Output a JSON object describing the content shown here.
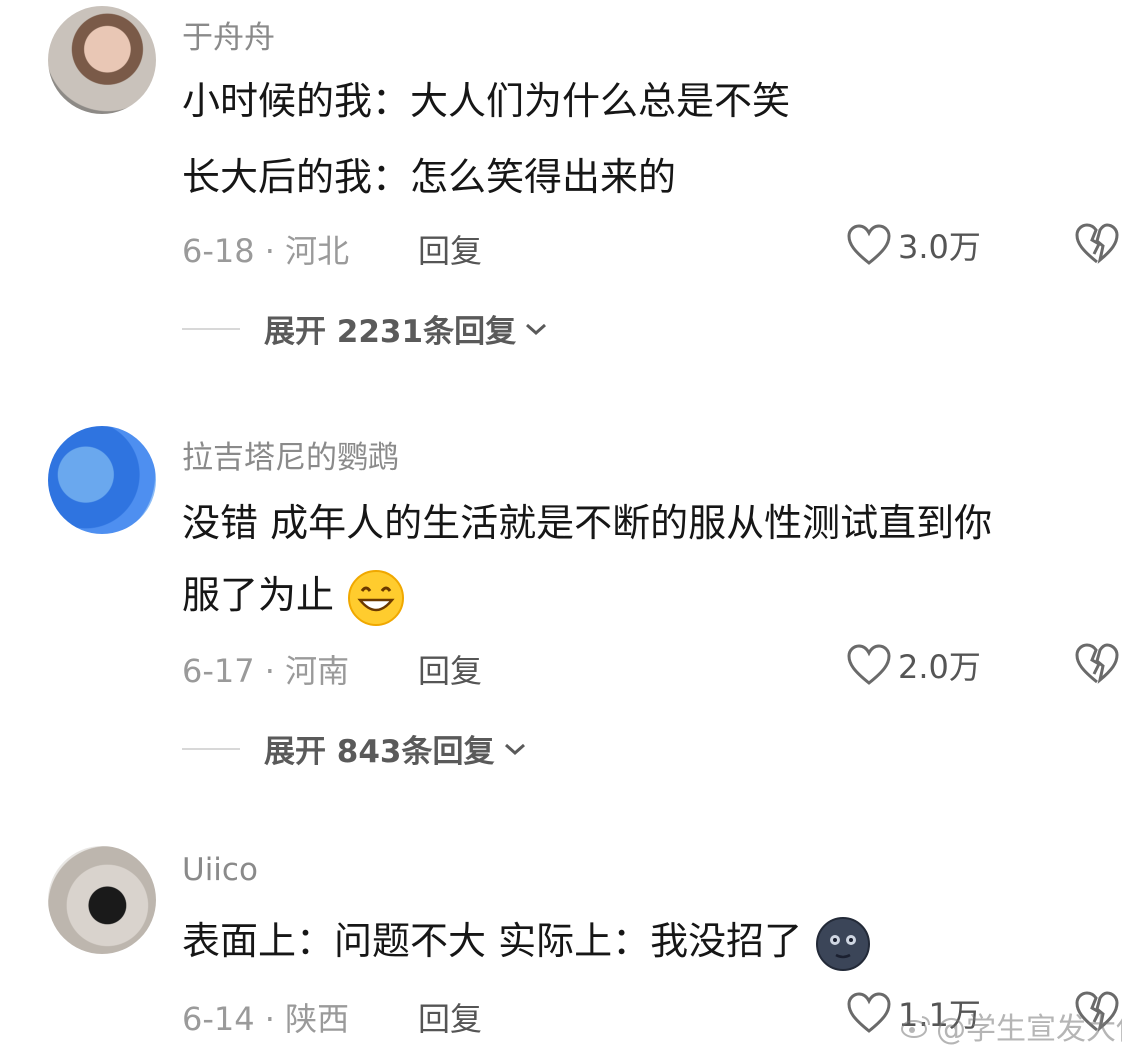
{
  "comments": [
    {
      "username": "于舟舟",
      "lines": [
        "小时候的我：大人们为什么总是不笑",
        "长大后的我：怎么笑得出来的"
      ],
      "date_location": "6-18 · 河北",
      "reply_label": "回复",
      "likes": "3.0万",
      "expand_label": "展开 2231条回复"
    },
    {
      "username": "拉吉塔尼的鹦鹉",
      "lines": [
        "没错 成年人的生活就是不断的服从性测试直到你",
        "服了为止"
      ],
      "date_location": "6-17 · 河南",
      "reply_label": "回复",
      "likes": "2.0万",
      "expand_label": "展开 843条回复"
    },
    {
      "username": "Uiico",
      "lines": [
        "表面上：问题不大 实际上：我没招了"
      ],
      "date_location": "6-14 · 陕西",
      "reply_label": "回复",
      "likes": "1.1万"
    }
  ],
  "watermark": "@学生宣发大使",
  "icons": {
    "like": "heart-outline-icon",
    "dislike": "broken-heart-icon",
    "expand": "chevron-down-icon",
    "emoji_grin": "grinning-face-emoji",
    "emoji_moon": "new-moon-face-emoji"
  }
}
